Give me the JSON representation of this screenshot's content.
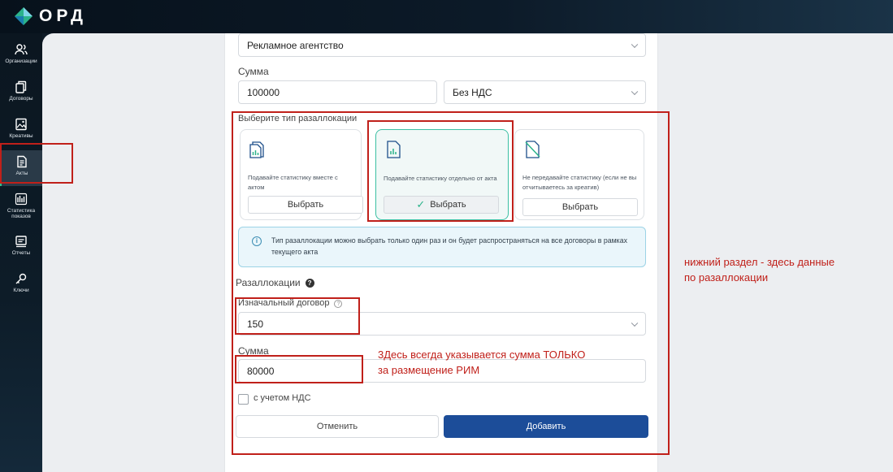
{
  "app": {
    "logo_text": "ОРД"
  },
  "sidebar": {
    "items": [
      {
        "label": "Организации",
        "icon": "users-icon"
      },
      {
        "label": "Договоры",
        "icon": "documents-icon"
      },
      {
        "label": "Креативы",
        "icon": "image-icon"
      },
      {
        "label": "Акты",
        "icon": "document-icon",
        "active": true
      },
      {
        "label": "Статистика показов",
        "icon": "stats-icon"
      },
      {
        "label": "Отчеты",
        "icon": "report-icon"
      },
      {
        "label": "Ключи",
        "icon": "key-icon"
      }
    ]
  },
  "form": {
    "role_value": "Рекламное агентство",
    "sum_label": "Сумма",
    "sum_value": "100000",
    "vat_value": "Без НДС",
    "allocation_type_label": "Выберите тип разаллокации",
    "cards": [
      {
        "text": "Подавайте статистику вместе с актом",
        "button": "Выбрать"
      },
      {
        "text": "Подавайте статистику отдельно от акта",
        "button": "Выбрать",
        "selected": true
      },
      {
        "text": "Не передавайте статистику (если не вы отчитываетесь за креатив)",
        "button": "Выбрать"
      }
    ],
    "info_text": "Тип разаллокации можно выбрать только один раз и он будет распространяться на все договоры в рамках текущего акта",
    "reallocations_label": "Разаллокации",
    "contract_label": "Изначальный договор",
    "contract_value": "150",
    "alloc_sum_label": "Сумма",
    "alloc_sum_value": "80000",
    "vat_checkbox_label": "с учетом НДС",
    "cancel_label": "Отменить",
    "add_label": "Добавить"
  },
  "annotations": {
    "right_note_line1": "нижний раздел - здесь данные",
    "right_note_line2": "по разаллокации",
    "sum_note_line1": "3Десь всегда указывается сумма ТОЛЬКО",
    "sum_note_line2": "за размещение РИМ",
    "color": "#c0201a"
  },
  "colors": {
    "accent_green": "#3bbfa3",
    "primary_button": "#1c4d99"
  }
}
